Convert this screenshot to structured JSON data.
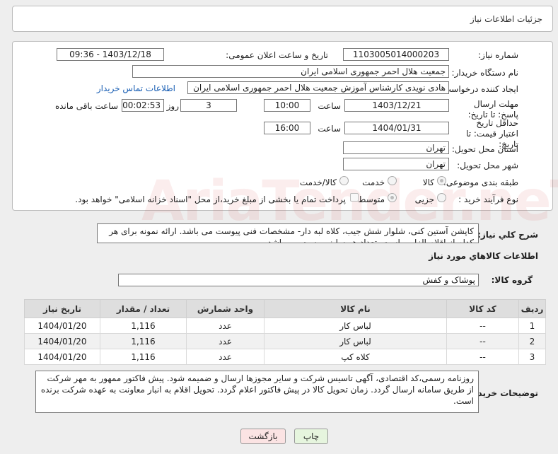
{
  "header": {
    "title": "جزئیات اطلاعات نیاز"
  },
  "form": {
    "need_number": {
      "label": "شماره نیاز:",
      "value": "1103005014000203"
    },
    "announce": {
      "label": "تاریخ و ساعت اعلان عمومی:",
      "value": "1403/12/18 - 09:36"
    },
    "buyer_org": {
      "label": "نام دستگاه خریدار:",
      "value": "جمعیت هلال احمر جمهوری اسلامی ایران"
    },
    "creator": {
      "label": "ایجاد کننده درخواست:",
      "value": "هادی نویدی کارشناس آموزش جمعیت هلال احمر جمهوری اسلامی ایران",
      "contact_link": "اطلاعات تماس خریدار"
    },
    "deadline": {
      "label": "مهلت ارسال پاسخ: تا تاریخ:",
      "date": "1403/12/21",
      "time_label": "ساعت",
      "time": "10:00",
      "days": "3",
      "days_label": "روز و",
      "remaining": "00:02:53",
      "remaining_label": "ساعت باقی مانده"
    },
    "validity": {
      "label": "حداقل تاریخ اعتبار قیمت: تا تاریخ:",
      "date": "1404/01/31",
      "time_label": "ساعت",
      "time": "16:00"
    },
    "province": {
      "label": "استان محل تحویل:",
      "value": "تهران"
    },
    "city": {
      "label": "شهر محل تحویل:",
      "value": "تهران"
    },
    "category": {
      "label": "طبقه بندی موضوعی:",
      "options": [
        "کالا",
        "خدمت",
        "کالا/خدمت"
      ]
    },
    "process": {
      "label": "نوع فرآیند خرید :",
      "options": [
        "جزیی",
        "متوسط"
      ],
      "note": "پرداخت تمام یا بخشی از مبلغ خرید،از محل \"اسناد خزانه اسلامی\" خواهد بود."
    }
  },
  "description": {
    "label": "شرح کلي نياز:",
    "text": "کاپشن آستین کنی، شلوار شش جیب، کلاه لبه دار- مشخصات فنی پیوست می باشد. ارائه نمونه برای هر کدام از اقلام الزامی است. تعداد هر سایز پیوست می باشد."
  },
  "goods_info": {
    "title": "اطلاعات کالاهاي مورد نياز"
  },
  "goods_group": {
    "label": "گروه کالا:",
    "value": "پوشاک و کفش"
  },
  "table": {
    "headers": [
      "ردیف",
      "کد کالا",
      "نام کالا",
      "واحد شمارش",
      "تعداد / مقدار",
      "تاریخ نیاز"
    ],
    "rows": [
      [
        "1",
        "--",
        "لباس کار",
        "عدد",
        "1,116",
        "1404/01/20"
      ],
      [
        "2",
        "--",
        "لباس کار",
        "عدد",
        "1,116",
        "1404/01/20"
      ],
      [
        "3",
        "--",
        "کلاه کپ",
        "عدد",
        "1,116",
        "1404/01/20"
      ]
    ]
  },
  "buyer_notes": {
    "label": "توضیحات خریدار:",
    "text": "روزنامه رسمی،کد اقتصادی، آگهی تاسیس شرکت و سایر مجوزها ارسال و ضمیمه شود. پیش فاکتور ممهور به مهر شرکت از طریق سامانه ارسال گردد. زمان تحویل کالا در پیش فاکتور اعلام گردد. تحویل اقلام به انبار معاونت به عهده شرکت برنده است."
  },
  "buttons": {
    "print": "چاپ",
    "back": "بازگشت"
  },
  "watermark": {
    "text": "AriaTender.neT"
  }
}
